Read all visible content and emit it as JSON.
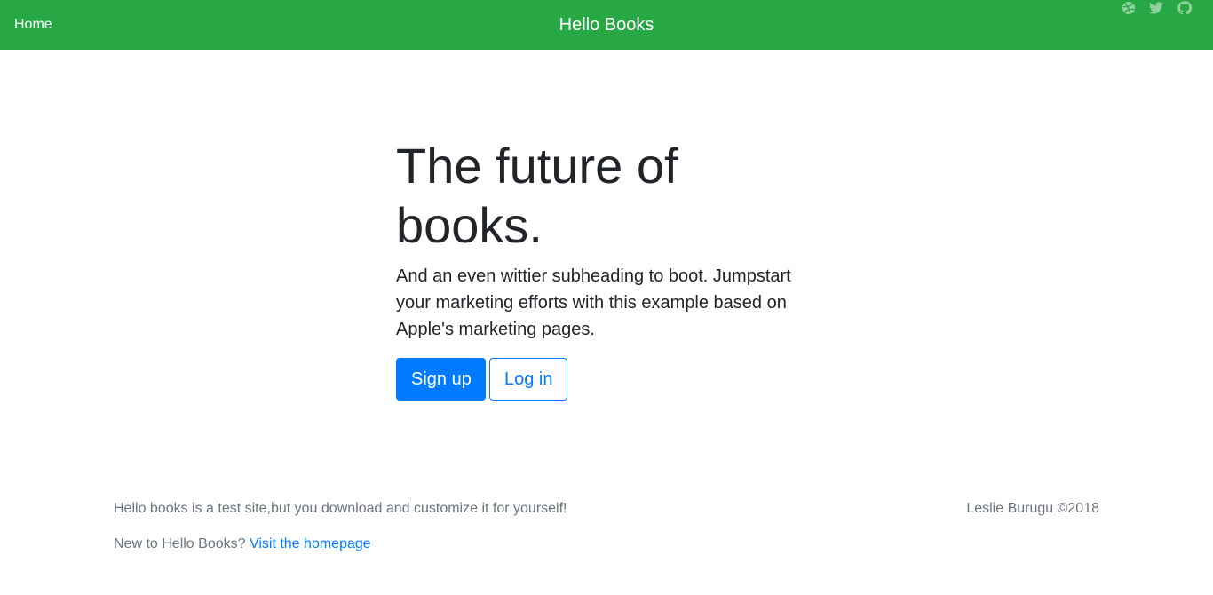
{
  "navbar": {
    "home_label": "Home",
    "brand": "Hello Books",
    "background_color": "#28a745",
    "social_icons": [
      "dribbble-icon",
      "twitter-icon",
      "github-icon"
    ]
  },
  "hero": {
    "title": "The future of books.",
    "lead": "And an even wittier subheading to boot. Jumpstart your marketing efforts with this example based on Apple's marketing pages.",
    "signup_label": "Sign up",
    "login_label": "Log in",
    "accent_color": "#007bff"
  },
  "footer": {
    "tagline": "Hello books is a test site,but you download and customize it for yourself!",
    "new_prompt": "New to Hello Books?",
    "homepage_link": "Visit the homepage",
    "copyright": "Leslie Burugu ©2018"
  }
}
